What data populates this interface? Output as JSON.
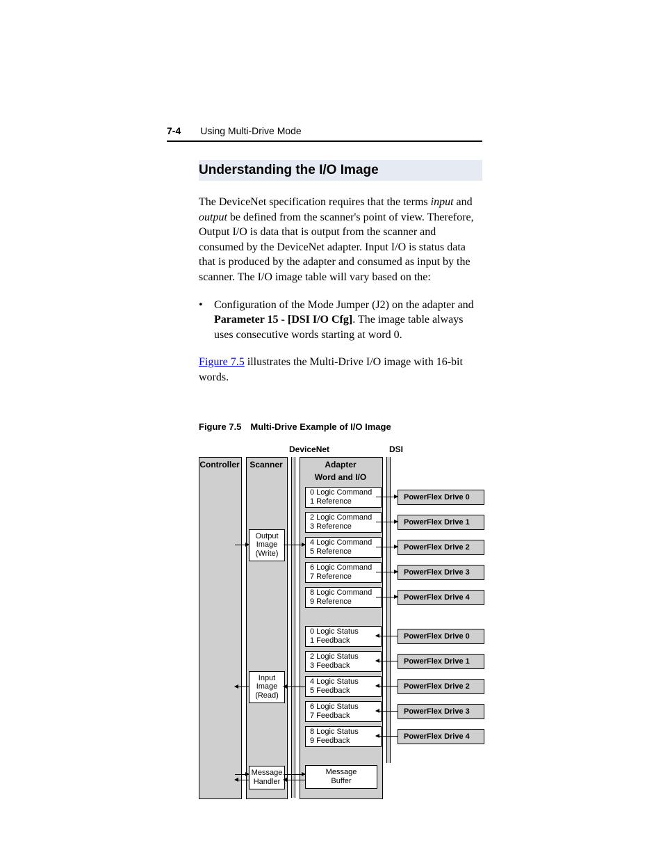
{
  "header": {
    "page_num": "7-4",
    "chapter": "Using Multi-Drive Mode"
  },
  "section_title": "Understanding the I/O Image",
  "para1": {
    "p1a": "The DeviceNet specification requires that the terms ",
    "i1": "input",
    "p1b": " and ",
    "i2": "output",
    "p1c": " be defined from the scanner's point of view. Therefore, Output I/O is data that is output from the scanner and consumed by the DeviceNet adapter. Input I/O is status data that is produced by the adapter and consumed as input by the scanner. The I/O image table will vary based on the:"
  },
  "bullet1": {
    "l1": "Configuration of the Mode Jumper (J2) on the adapter and ",
    "b1": "Parameter 15 - [DSI I/O Cfg]",
    "l2": ". The image table always uses consecutive words starting at word 0."
  },
  "para2": {
    "link": "Figure 7.5",
    "rest": " illustrates the Multi-Drive I/O image with 16-bit words."
  },
  "fig_caption": "Figure 7.5 Multi-Drive Example of I/O Image",
  "diagram": {
    "devicenet": "DeviceNet",
    "dsi": "DSI",
    "controller": "Controller",
    "scanner": "Scanner",
    "adapter": "Adapter",
    "word_io": "Word and I/O",
    "scanner_boxes": {
      "out1": "Output",
      "out2": "Image",
      "out3": "(Write)",
      "in1": "Input",
      "in2": "Image",
      "in3": "(Read)",
      "mh1": "Message",
      "mh2": "Handler"
    },
    "adapter_out": [
      {
        "a": "0 Logic Command",
        "b": "1 Reference"
      },
      {
        "a": "2 Logic Command",
        "b": "3 Reference"
      },
      {
        "a": "4 Logic Command",
        "b": "5 Reference"
      },
      {
        "a": "6 Logic Command",
        "b": "7 Reference"
      },
      {
        "a": "8 Logic Command",
        "b": "9 Reference"
      }
    ],
    "adapter_in": [
      {
        "a": "0 Logic Status",
        "b": "1 Feedback"
      },
      {
        "a": "2 Logic Status",
        "b": "3 Feedback"
      },
      {
        "a": "4 Logic Status",
        "b": "5 Feedback"
      },
      {
        "a": "6 Logic Status",
        "b": "7 Feedback"
      },
      {
        "a": "8 Logic Status",
        "b": "9 Feedback"
      }
    ],
    "msg_buf": {
      "a": "Message",
      "b": "Buffer"
    },
    "drives": [
      "PowerFlex Drive 0",
      "PowerFlex Drive 1",
      "PowerFlex Drive 2",
      "PowerFlex Drive 3",
      "PowerFlex Drive 4"
    ]
  }
}
